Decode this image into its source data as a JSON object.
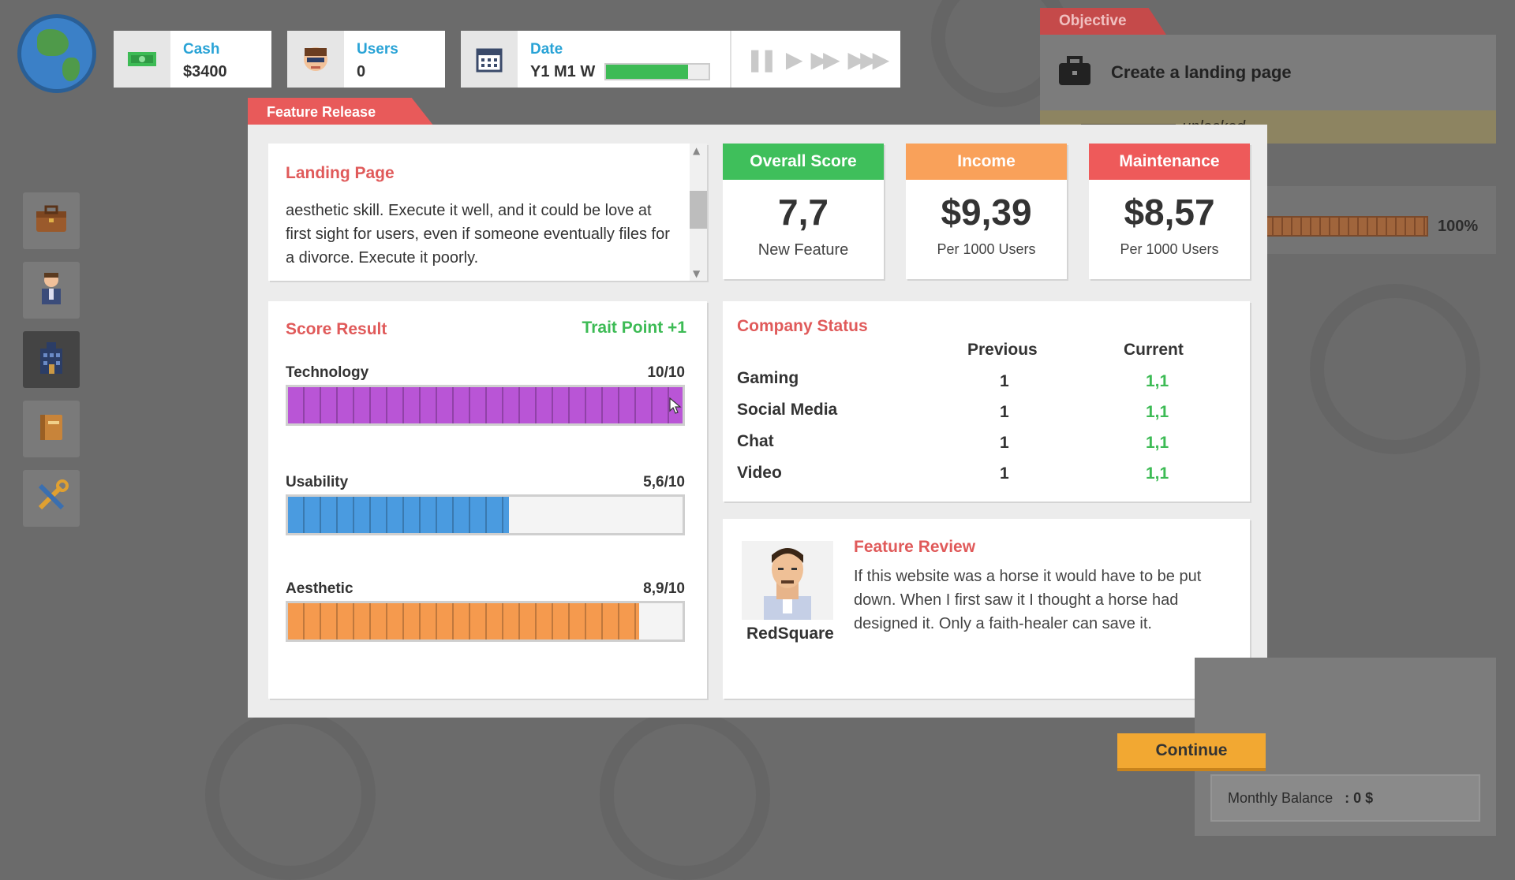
{
  "topbar": {
    "cash": {
      "label": "Cash",
      "value": "$3400"
    },
    "users": {
      "label": "Users",
      "value": "0"
    },
    "date": {
      "label": "Date",
      "value": "Y1 M1 W",
      "week_progress": 0.8
    },
    "speed_controls": [
      "pause",
      "play",
      "fast",
      "fastest"
    ]
  },
  "objective": {
    "tab_label": "Objective",
    "task": "Create a landing page",
    "note": "unlocked",
    "progress_label": "100%",
    "progress": 1.0
  },
  "sidebar": {
    "items": [
      {
        "icon": "briefcase-icon"
      },
      {
        "icon": "employee-icon"
      },
      {
        "icon": "office-building-icon"
      },
      {
        "icon": "book-icon"
      },
      {
        "icon": "tools-icon"
      }
    ]
  },
  "modal": {
    "tab_label": "Feature Release",
    "feature": {
      "title": "Landing Page",
      "description": "aesthetic skill. Execute it well, and it could be love at first sight for users, even if someone eventually files for a divorce. Execute it poorly."
    },
    "stats": {
      "overall": {
        "title": "Overall Score",
        "value": "7,7",
        "sub": "New Feature"
      },
      "income": {
        "title": "Income",
        "value": "$9,39",
        "sub": "Per 1000 Users"
      },
      "maintenance": {
        "title": "Maintenance",
        "value": "$8,57",
        "sub": "Per 1000 Users"
      }
    },
    "score_result": {
      "title": "Score Result",
      "trait": "Trait Point +1",
      "rows": [
        {
          "name": "Technology",
          "score_text": "10/10",
          "score": 10,
          "color": "#b955d6"
        },
        {
          "name": "Usability",
          "score_text": "5,6/10",
          "score": 5.6,
          "color": "#4a9be0"
        },
        {
          "name": "Aesthetic",
          "score_text": "8,9/10",
          "score": 8.9,
          "color": "#f59a4e"
        }
      ]
    },
    "company_status": {
      "title": "Company Status",
      "col_previous": "Previous",
      "col_current": "Current",
      "rows": [
        {
          "name": "Gaming",
          "previous": "1",
          "current": "1,1"
        },
        {
          "name": "Social Media",
          "previous": "1",
          "current": "1,1"
        },
        {
          "name": "Chat",
          "previous": "1",
          "current": "1,1"
        },
        {
          "name": "Video",
          "previous": "1",
          "current": "1,1"
        }
      ]
    },
    "review": {
      "title": "Feature Review",
      "reviewer": "RedSquare",
      "text": "If this website was a horse it would have to be put down. When I first saw it I thought a horse had designed it. Only a faith-healer can save it."
    }
  },
  "continue_label": "Continue",
  "monthly_balance": {
    "label": "Monthly Balance",
    "value": ": 0 $"
  },
  "colors": {
    "accent_red": "#e85a5a",
    "green": "#3dbb55",
    "income_orange": "#f9a15a",
    "maintenance_red": "#ee5a5a",
    "overall_green": "#3fbf5b"
  }
}
